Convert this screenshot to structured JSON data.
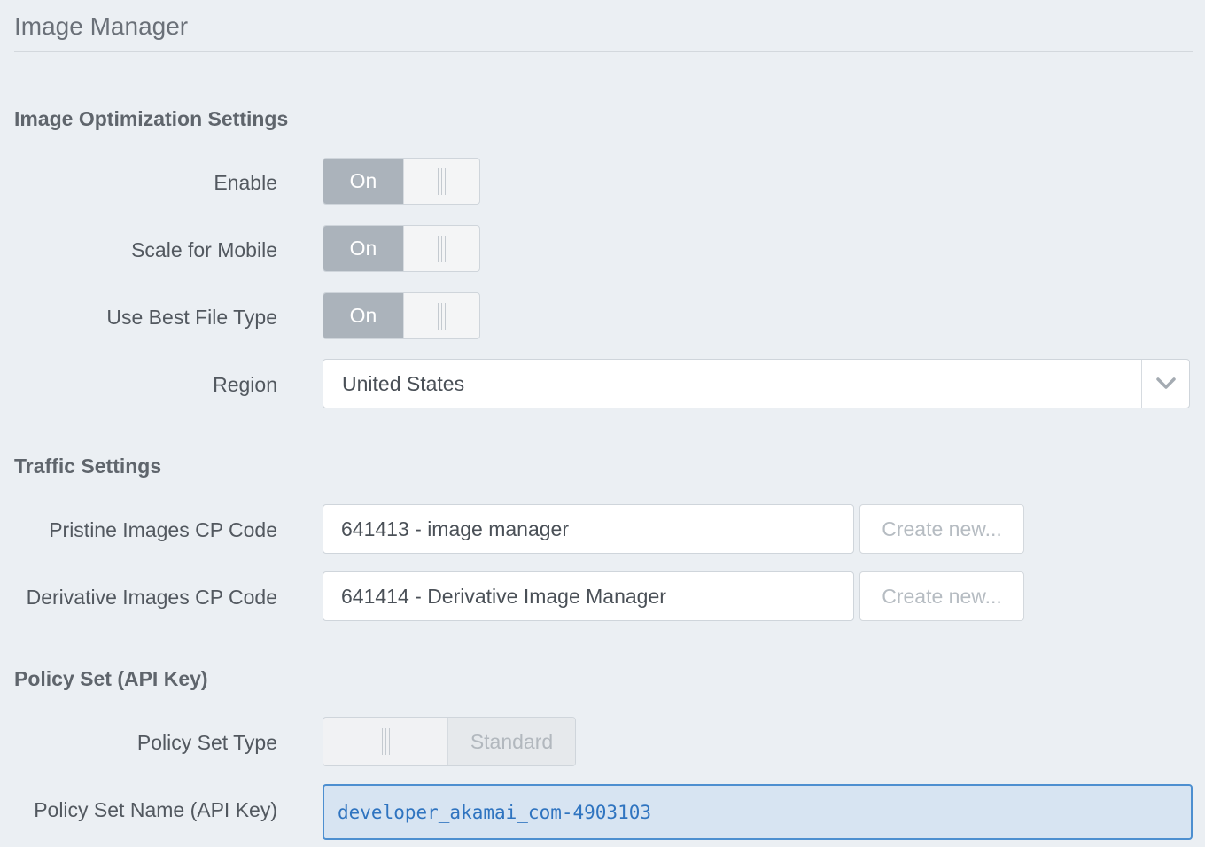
{
  "header": {
    "title": "Image Manager"
  },
  "image_optimization": {
    "heading": "Image Optimization Settings",
    "enable": {
      "label": "Enable",
      "state": "On"
    },
    "scale_for_mobile": {
      "label": "Scale for Mobile",
      "state": "On"
    },
    "use_best_file_type": {
      "label": "Use Best File Type",
      "state": "On"
    },
    "region": {
      "label": "Region",
      "value": "United States"
    }
  },
  "traffic": {
    "heading": "Traffic Settings",
    "pristine": {
      "label": "Pristine Images CP Code",
      "value": "641413 - image manager",
      "button": "Create new..."
    },
    "derivative": {
      "label": "Derivative Images CP Code",
      "value": "641414 - Derivative Image Manager",
      "button": "Create new..."
    }
  },
  "policy_set": {
    "heading": "Policy Set (API Key)",
    "type": {
      "label": "Policy Set Type",
      "value": "Standard"
    },
    "name": {
      "label": "Policy Set Name (API Key)",
      "value": "developer_akamai_com-4903103"
    }
  },
  "icons": {
    "toggle_handle": "grip-lines-icon",
    "select_arrow": "chevron-down-icon"
  },
  "colors": {
    "background": "#ebeff3",
    "toggle_on": "#abb3bb",
    "focus_border": "#4d8fd0",
    "focus_fill": "#d7e4f2",
    "api_key_text": "#2f74c0"
  }
}
